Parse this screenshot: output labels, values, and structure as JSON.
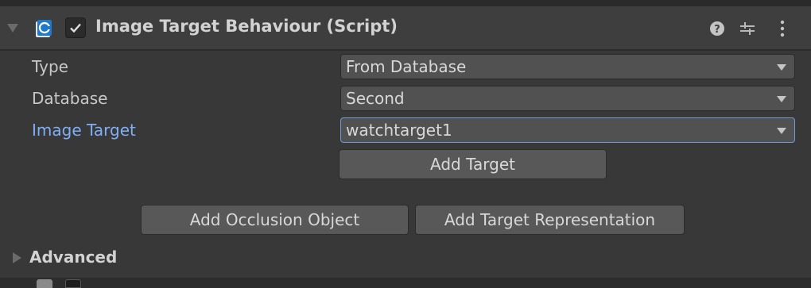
{
  "component": {
    "title": "Image Target Behaviour (Script)",
    "enabled": true,
    "icons": [
      "help-icon",
      "preset-icon",
      "kebab-menu-icon"
    ]
  },
  "fields": [
    {
      "label": "Type",
      "value": "From Database"
    },
    {
      "label": "Database",
      "value": "Second"
    },
    {
      "label": "Image Target",
      "value": "watchtarget1"
    }
  ],
  "buttons": {
    "add_target": "Add Target",
    "add_occlusion": "Add Occlusion Object",
    "add_representation": "Add Target Representation"
  },
  "advanced": {
    "label": "Advanced"
  },
  "colors": {
    "panel": "#383838",
    "header": "#3e3e3e",
    "accent_label": "#7fb0f5",
    "focus_border": "#6e9ad6",
    "script_icon": "#1f78c8"
  }
}
